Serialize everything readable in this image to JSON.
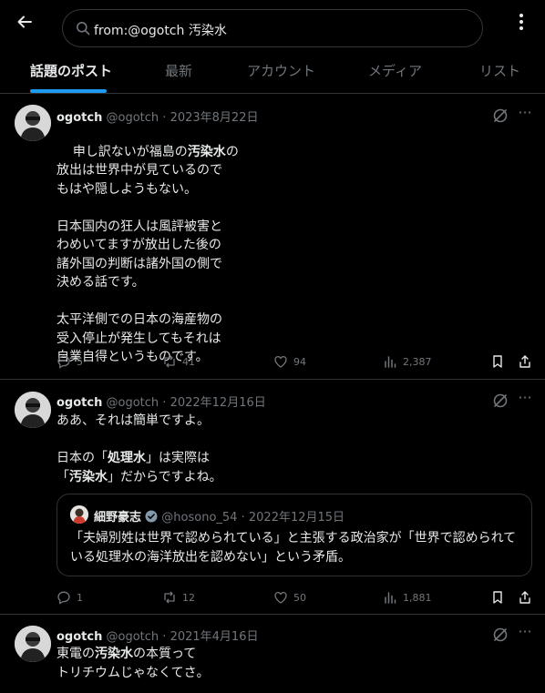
{
  "search": {
    "query": "from:@ogotch 汚染水"
  },
  "tabs": [
    "話題のポスト",
    "最新",
    "アカウント",
    "メディア",
    "リスト"
  ],
  "posts": [
    {
      "name": "ogotch",
      "handle": "@ogotch",
      "sep": "·",
      "date": "2023年8月22日",
      "lines": [
        [
          "申し訳ないが福島の",
          "汚染水",
          "の"
        ],
        [
          "放出は世界中が見ているので"
        ],
        [
          "もはや隠しようもない。"
        ],
        [
          ""
        ],
        [
          "日本国内の狂人は風評被害と"
        ],
        [
          "わめいてますが放出した後の"
        ],
        [
          "諸外国の判断は諸外国の側で"
        ],
        [
          "決める話です。"
        ],
        [
          ""
        ],
        [
          "太平洋側での日本の海産物の"
        ],
        [
          "受入停止が発生してもそれは"
        ],
        [
          "自業自得というものです。"
        ]
      ],
      "replies": "5",
      "reposts": "41",
      "likes": "94",
      "views": "2,387"
    },
    {
      "name": "ogotch",
      "handle": "@ogotch",
      "sep": "·",
      "date": "2022年12月16日",
      "lines": [
        [
          "ああ、それは簡単ですよ。"
        ],
        [
          ""
        ],
        [
          "日本の「",
          "処理水",
          "」は実際は"
        ],
        [
          "「",
          "汚染水",
          "」だからですよね。"
        ]
      ],
      "quote": {
        "name": "細野豪志",
        "handle": "@hosono_54",
        "sep": "·",
        "date": "2022年12月15日",
        "text": "「夫婦別姓は世界で認められている」と主張する政治家が「世界で認められている処理水の海洋放出を認めない」という矛盾。"
      },
      "replies": "1",
      "reposts": "12",
      "likes": "50",
      "views": "1,881"
    },
    {
      "name": "ogotch",
      "handle": "@ogotch",
      "sep": "·",
      "date": "2021年4月16日",
      "lines": [
        [
          "東電の",
          "汚染水",
          "の本質って"
        ],
        [
          "トリチウムじゃなくてさ。"
        ]
      ]
    }
  ],
  "colors": {
    "accent": "#1d9bf0",
    "verified": "#829aab",
    "muted": "#71767b",
    "text": "#e7e9ea",
    "border": "#2f3336"
  },
  "icons": [
    "back-arrow-icon",
    "search-icon",
    "more-icon",
    "grok-icon",
    "reply-icon",
    "repost-icon",
    "like-icon",
    "views-icon",
    "bookmark-icon",
    "share-icon",
    "verified-badge-icon"
  ]
}
